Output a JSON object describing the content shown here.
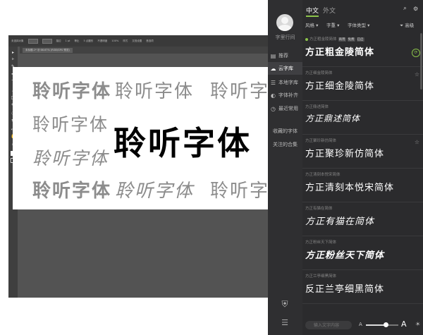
{
  "illustrator": {
    "toolbar_labels": [
      "未选择对象",
      "描边",
      "1 pt",
      "等比",
      "5 点圆形",
      "不透明度",
      "100%",
      "样式",
      "文档设置",
      "首选项"
    ],
    "doc_tab": "未标题-1* @ 66.67% (RGB/GPU 预览)",
    "tools": [
      "▸",
      "▹",
      "✎",
      "✒",
      "T",
      "/",
      "□",
      "✎",
      "◌",
      "↻",
      "⤢",
      "✋",
      "⌕"
    ],
    "artwork": {
      "row1": [
        "聆听字体",
        "聆听字体",
        "聆听字体"
      ],
      "row2": [
        "聆听字体",
        "聆听字体"
      ],
      "row3": [
        "聆听字体"
      ],
      "row4": [
        "聆听字体",
        "聆听字体",
        "聆听字体"
      ]
    }
  },
  "panel": {
    "username": "字里行间",
    "nav": [
      {
        "icon": "list-icon",
        "glyph": "▤",
        "label": "推荐"
      },
      {
        "icon": "cloud-icon",
        "glyph": "☁",
        "label": "云字库"
      },
      {
        "icon": "grid-icon",
        "glyph": "☰",
        "label": "本地字库"
      },
      {
        "icon": "contrast-icon",
        "glyph": "◐",
        "label": "字体补齐"
      },
      {
        "icon": "clock-icon",
        "glyph": "◷",
        "label": "最近常用"
      }
    ],
    "collections": [
      "收藏的字体",
      "关注的合集"
    ],
    "tabs": {
      "cn": "中文",
      "en": "外文"
    },
    "filters": {
      "style": "风格",
      "weight": "字重",
      "type": "字体类型",
      "advanced": "高级"
    },
    "fonts": [
      {
        "name": "方正粗金陵简体",
        "preview": "方正粗金陵简体",
        "tags": [
          "商用",
          "免费",
          "已启"
        ],
        "active": true
      },
      {
        "name": "方正细金陵简体",
        "preview": "方正细金陵简体",
        "starred": true
      },
      {
        "name": "方正鼎述简体",
        "preview": "方正鼎述简体"
      },
      {
        "name": "方正聚珍新仿简体",
        "preview": "方正聚珍新仿简体",
        "starred": true
      },
      {
        "name": "方正清刻本悦宋简体",
        "preview": "方正清刻本悦宋简体"
      },
      {
        "name": "方正有猫在简体",
        "preview": "方正有猫在简体"
      },
      {
        "name": "方正粉丝天下简体",
        "preview": "方正粉丝天下简体"
      },
      {
        "name": "方正兰亭细黑简体",
        "preview": "反正兰亭细黑简体"
      }
    ],
    "input_placeholder": "输入文字内容",
    "size_small": "A",
    "size_big": "A",
    "size_level": 0.6,
    "colors": {
      "accent": "#8bc34a",
      "panel_bg": "#2b2b2d",
      "sidebar_bg": "#2f2f31"
    }
  }
}
